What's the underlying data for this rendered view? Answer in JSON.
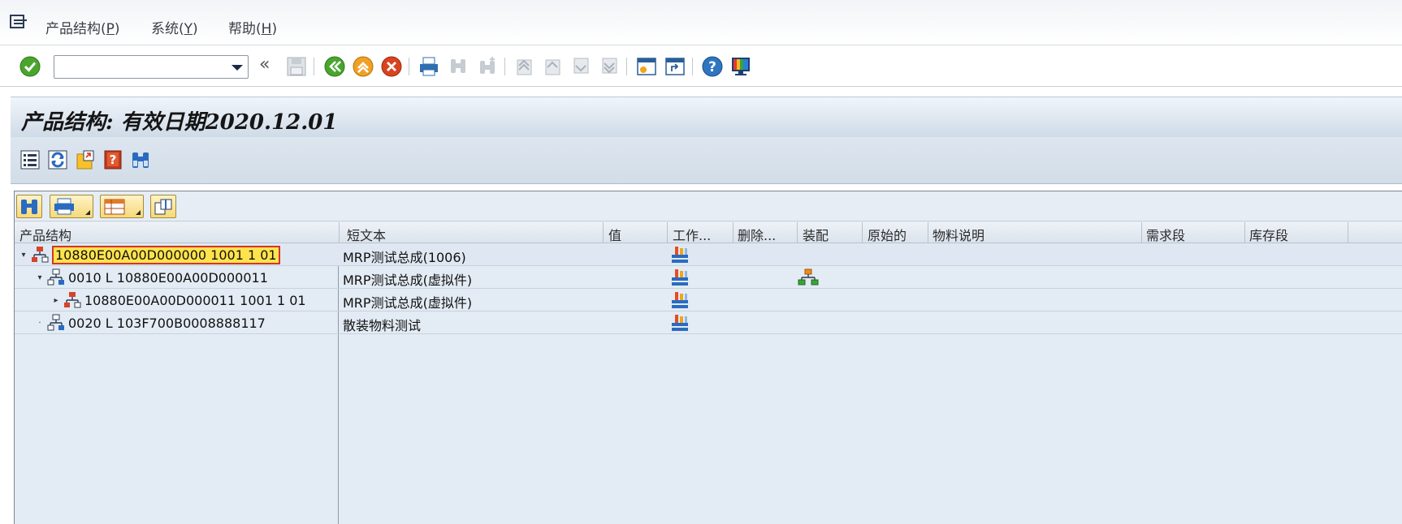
{
  "menu": {
    "items": [
      {
        "label": "产品结构(",
        "key": "P",
        "suffix": ")"
      },
      {
        "label": "系统(",
        "key": "Y",
        "suffix": ")"
      },
      {
        "label": "帮助(",
        "key": "H",
        "suffix": ")"
      }
    ]
  },
  "toolbar": {
    "command_value": "",
    "back_glyph": "«"
  },
  "title": {
    "text": "产品结构: 有效日期2020.12.01"
  },
  "columns": [
    "产品结构",
    "短文本",
    "值",
    "工作...",
    "删除...",
    "装配",
    "原始的",
    "物料说明",
    "需求段",
    "库存段"
  ],
  "rows": [
    {
      "tree_label": "10880E00A00D000000 1001 1 01",
      "short_text": "MRP测试总成(1006)",
      "expand": "▾",
      "level": 0,
      "node_color": "red",
      "selected": true,
      "work": true,
      "assembly": false
    },
    {
      "tree_label": "0010 L 10880E00A00D000011",
      "short_text": "MRP测试总成(虚拟件)",
      "expand": "▾",
      "level": 1,
      "node_color": "blue",
      "selected": false,
      "work": true,
      "assembly": true
    },
    {
      "tree_label": "10880E00A00D000011 1001 1 01",
      "short_text": "MRP测试总成(虚拟件)",
      "expand": "▸",
      "level": 2,
      "node_color": "red",
      "selected": false,
      "work": true,
      "assembly": false
    },
    {
      "tree_label": "0020 L 103F700B0008888117",
      "short_text": "散装物料测试",
      "expand": "·",
      "level": 1,
      "node_color": "blue",
      "selected": false,
      "work": true,
      "assembly": false
    }
  ],
  "colors": {
    "selection_fill": "#ffe34d",
    "selection_border": "#d4342a",
    "panel_bg": "#e3ebf4"
  }
}
